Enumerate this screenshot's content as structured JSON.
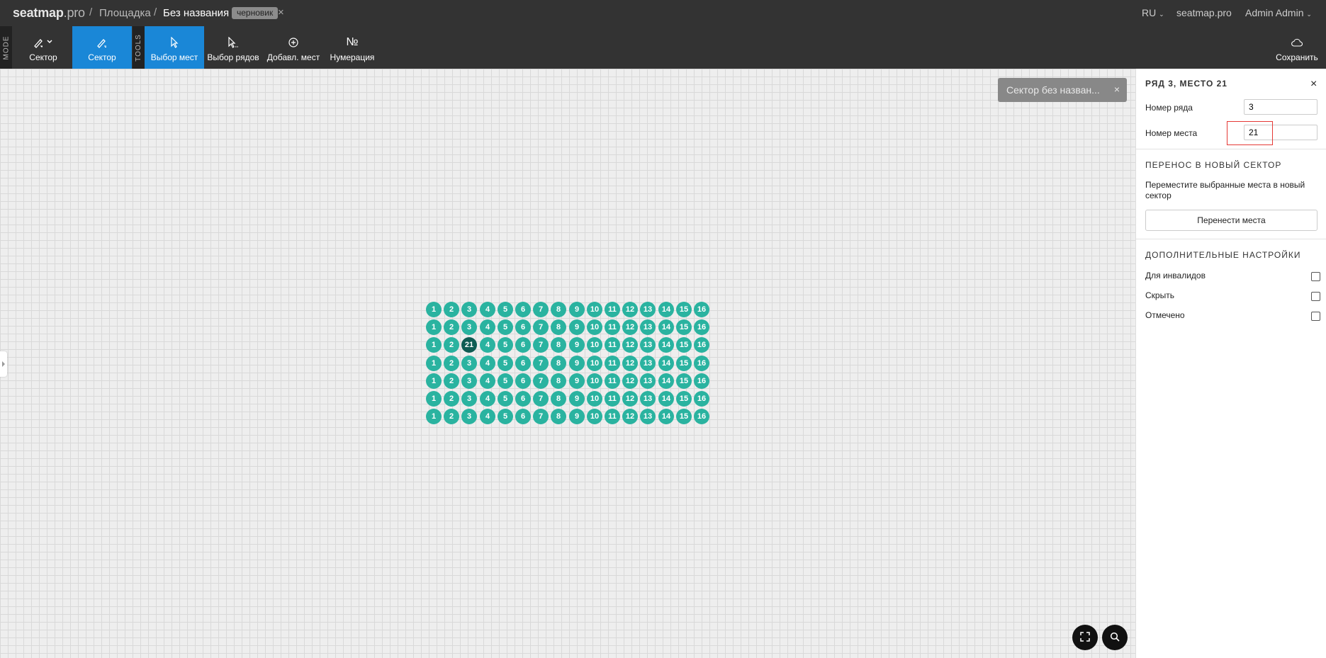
{
  "header": {
    "brand": "seatmap",
    "brand_suffix": ".pro",
    "breadcrumb_venue": "Площадка",
    "breadcrumb_title": "Без названия",
    "separator": "/",
    "status_badge": "черновик",
    "close_symbol": "×",
    "language": "RU",
    "link_site": "seatmap.pro",
    "user_name": "Admin Admin"
  },
  "toolbar": {
    "mode_label": "MODE",
    "tools_label": "TOOLS",
    "mode_item": "Сектор",
    "sector": "Сектор",
    "select_seats": "Выбор мест",
    "select_rows": "Выбор рядов",
    "add_seats": "Добавл. мест",
    "numbering": "Нумерация",
    "numbering_glyph": "№",
    "save": "Сохранить"
  },
  "canvas": {
    "sector_chip": "Сектор без назван...",
    "sector_chip_close": "×",
    "rows": [
      [
        "1",
        "2",
        "3",
        "4",
        "5",
        "6",
        "7",
        "8",
        "9",
        "10",
        "11",
        "12",
        "13",
        "14",
        "15",
        "16"
      ],
      [
        "1",
        "2",
        "3",
        "4",
        "5",
        "6",
        "7",
        "8",
        "9",
        "10",
        "11",
        "12",
        "13",
        "14",
        "15",
        "16"
      ],
      [
        "1",
        "2",
        "21",
        "4",
        "5",
        "6",
        "7",
        "8",
        "9",
        "10",
        "11",
        "12",
        "13",
        "14",
        "15",
        "16"
      ],
      [
        "1",
        "2",
        "3",
        "4",
        "5",
        "6",
        "7",
        "8",
        "9",
        "10",
        "11",
        "12",
        "13",
        "14",
        "15",
        "16"
      ],
      [
        "1",
        "2",
        "3",
        "4",
        "5",
        "6",
        "7",
        "8",
        "9",
        "10",
        "11",
        "12",
        "13",
        "14",
        "15",
        "16"
      ],
      [
        "1",
        "2",
        "3",
        "4",
        "5",
        "6",
        "7",
        "8",
        "9",
        "10",
        "11",
        "12",
        "13",
        "14",
        "15",
        "16"
      ],
      [
        "1",
        "2",
        "3",
        "4",
        "5",
        "6",
        "7",
        "8",
        "9",
        "10",
        "11",
        "12",
        "13",
        "14",
        "15",
        "16"
      ]
    ],
    "selected_seat": {
      "row": 3,
      "number": "21"
    },
    "colors": {
      "seat": "#2ab3a0",
      "seat_selected": "#0f5c53"
    }
  },
  "panel": {
    "title": "РЯД 3, МЕСТО 21",
    "close_symbol": "×",
    "row_label": "Номер ряда",
    "row_value": "3",
    "seat_label": "Номер места",
    "seat_value": "21",
    "move_heading": "ПЕРЕНОС В НОВЫЙ СЕКТОР",
    "move_desc": "Переместите выбранные места в новый сектор",
    "move_button": "Перенести места",
    "extra_heading": "ДОПОЛНИТЕЛЬНЫЕ НАСТРОЙКИ",
    "options": [
      {
        "label": "Для инвалидов",
        "checked": false
      },
      {
        "label": "Скрыть",
        "checked": false
      },
      {
        "label": "Отмечено",
        "checked": false
      }
    ]
  },
  "accent_color": "#1a87d7"
}
